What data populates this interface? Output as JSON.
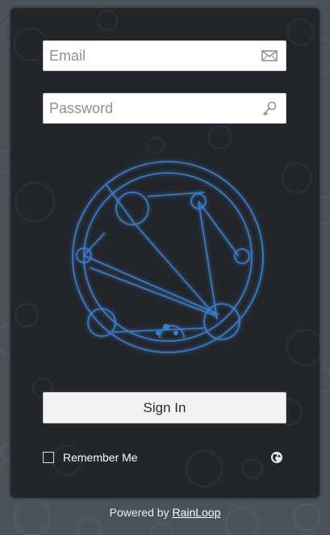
{
  "login": {
    "email_placeholder": "Email",
    "password_placeholder": "Password",
    "sign_in_label": "Sign In",
    "remember_label": "Remember Me",
    "remember_checked": false
  },
  "footer": {
    "powered_by": "Powered by",
    "brand_link": "RainLoop"
  },
  "icons": {
    "email": "envelope-icon",
    "password": "key-icon",
    "language": "globe-icon",
    "logo": "circular-gallifreyan-logo"
  },
  "colors": {
    "page_background": "#4a525b",
    "card_background": "#22262b",
    "logo_stroke": "#3d7ec9",
    "button_background": "#f2f2f2"
  }
}
